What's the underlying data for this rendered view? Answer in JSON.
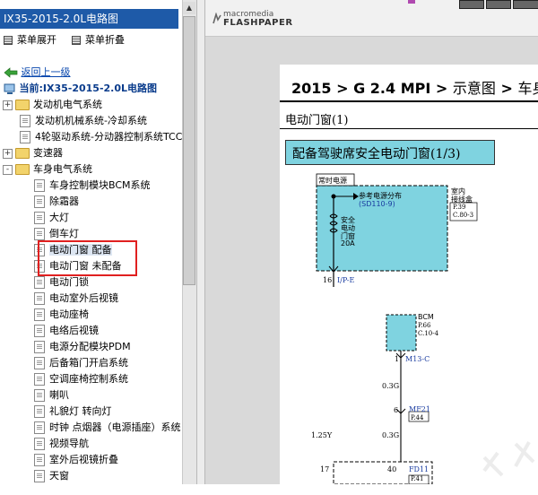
{
  "tree": {
    "title": "IX35-2015-2.0L电路图",
    "menu_expand": "菜单展开",
    "menu_collapse": "菜单折叠",
    "back_link": "返回上一级",
    "current": "当前:IX35-2015-2.0L电路图",
    "items": [
      {
        "label": "发动机电气系统",
        "type": "folder",
        "toggle": "+"
      },
      {
        "label": "发动机机械系统-冷却系统",
        "type": "doc"
      },
      {
        "label": "4轮驱动系统-分动器控制系统TCC",
        "type": "doc"
      },
      {
        "label": "变速器",
        "type": "folder",
        "toggle": "+"
      },
      {
        "label": "车身电气系统",
        "type": "folder",
        "toggle": "-"
      },
      {
        "label": "车身控制模块BCM系统",
        "type": "doc"
      },
      {
        "label": "除霜器",
        "type": "doc"
      },
      {
        "label": "大灯",
        "type": "doc"
      },
      {
        "label": "倒车灯",
        "type": "doc"
      },
      {
        "label": "电动门窗 配备",
        "type": "doc",
        "selected": true
      },
      {
        "label": "电动门窗 未配备",
        "type": "doc"
      },
      {
        "label": "电动门锁",
        "type": "doc"
      },
      {
        "label": "电动室外后视镜",
        "type": "doc"
      },
      {
        "label": "电动座椅",
        "type": "doc"
      },
      {
        "label": "电络后视镜",
        "type": "doc"
      },
      {
        "label": "电源分配模块PDM",
        "type": "doc"
      },
      {
        "label": "后备箱门开启系统",
        "type": "doc"
      },
      {
        "label": "空调座椅控制系统",
        "type": "doc"
      },
      {
        "label": "喇叭",
        "type": "doc"
      },
      {
        "label": "礼貌灯 转向灯",
        "type": "doc"
      },
      {
        "label": "时钟 点烟器（电源插座）系统",
        "type": "doc"
      },
      {
        "label": "视频导航",
        "type": "doc"
      },
      {
        "label": "室外后视镜折叠",
        "type": "doc"
      },
      {
        "label": "天窗",
        "type": "doc"
      }
    ]
  },
  "viewer": {
    "logo_top": "macromedia",
    "logo_bottom": "FLASHPAPER"
  },
  "doc": {
    "title_a": "2015",
    "title_b": "G 2.4 MPI",
    "title_c": "示意图",
    "title_d": "车身",
    "sep": ">",
    "subtitle": "电动门窗(1)",
    "banner": "配备驾驶席安全电动门窗(1/3)",
    "diagram": {
      "hot_label": "常时电源",
      "ref_label": "参考电源分布",
      "ref_code": "(SD110-9)",
      "room_label_1": "室内",
      "room_label_2": "接线盒",
      "room_p": "P.39",
      "room_c": "C.80-3",
      "fuse_1": "安全",
      "fuse_2": "电动",
      "fuse_3": "门窗",
      "fuse_amp": "20A",
      "pin_16": "16",
      "conn_ipe": "I/P-E",
      "bcm": "BCM",
      "bcm_p": "P.66",
      "bcm_c": "C.10-4",
      "pin_1": "1",
      "conn_m13c": "M13-C",
      "wire_03g_a": "0.3G",
      "pin_6": "6",
      "conn_mf21": "MF21",
      "mf21_p": "P.44",
      "wire_125y": "1.25Y",
      "wire_03g_b": "0.3G",
      "pin_17": "17",
      "pin_40": "40",
      "conn_fd11": "FD11",
      "fd11_p": "P.41"
    }
  }
}
